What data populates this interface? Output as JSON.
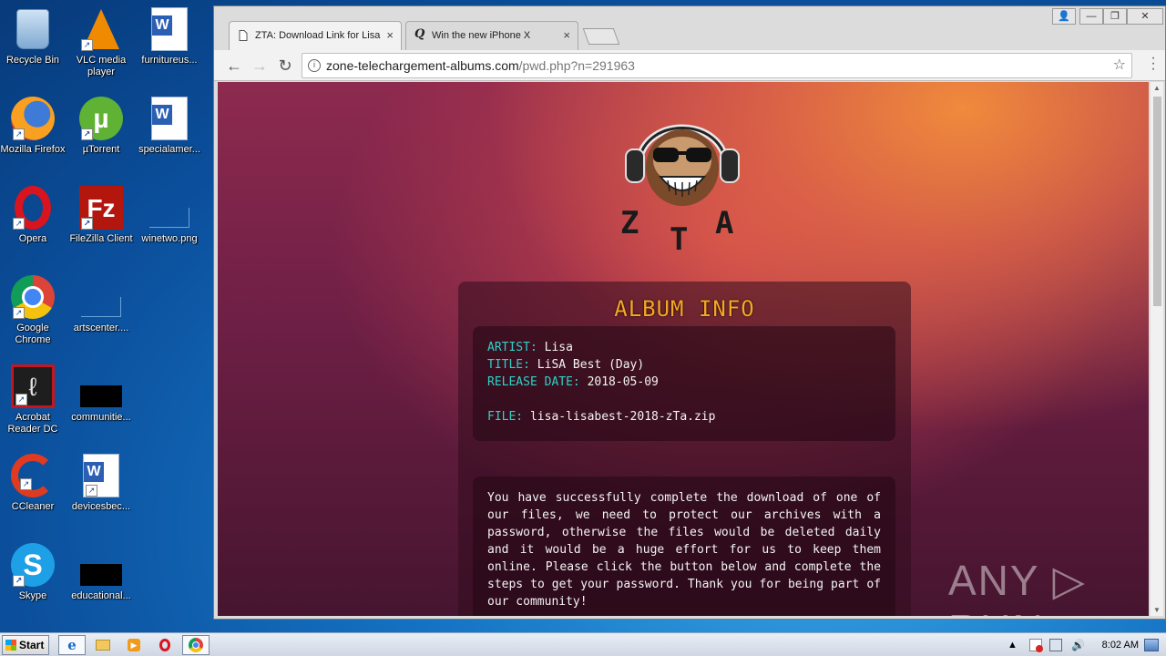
{
  "desktop": {
    "icons": [
      {
        "label": "Recycle Bin",
        "icon": "recycle-bin-icon"
      },
      {
        "label": "VLC media player",
        "icon": "vlc-icon"
      },
      {
        "label": "furnitureus...",
        "icon": "word-document-icon"
      },
      {
        "label": "Mozilla Firefox",
        "icon": "firefox-icon"
      },
      {
        "label": "µTorrent",
        "icon": "utorrent-icon"
      },
      {
        "label": "specialamer...",
        "icon": "word-document-icon"
      },
      {
        "label": "Opera",
        "icon": "opera-icon"
      },
      {
        "label": "FileZilla Client",
        "icon": "filezilla-icon"
      },
      {
        "label": "winetwo.png",
        "icon": "image-file-icon"
      },
      {
        "label": "Google Chrome",
        "icon": "chrome-icon"
      },
      {
        "label": "artscenter....",
        "icon": "file-icon"
      },
      {
        "label": "Acrobat Reader DC",
        "icon": "acrobat-icon"
      },
      {
        "label": "communitie...",
        "icon": "file-icon"
      },
      {
        "label": "CCleaner",
        "icon": "ccleaner-icon"
      },
      {
        "label": "devicesbec...",
        "icon": "word-document-icon"
      },
      {
        "label": "Skype",
        "icon": "skype-icon"
      },
      {
        "label": "educational...",
        "icon": "file-icon"
      }
    ]
  },
  "browser": {
    "tabs": [
      {
        "title": "ZTA: Download Link for Lisa",
        "close": "×",
        "active": true
      },
      {
        "title": "Win the new iPhone X",
        "close": "×",
        "active": false
      }
    ],
    "address": {
      "host": "zone-telechargement-albums.com",
      "path": "/pwd.php?n=291963"
    }
  },
  "page": {
    "logo_text": "ZTA",
    "album_title": "ALBUM INFO",
    "info": {
      "artist_label": "ARTIST:",
      "artist": "Lisa",
      "title_label": "TITLE:",
      "title": "LiSA Best (Day)",
      "release_label": "RELEASE DATE:",
      "release": "2018-05-09",
      "file_label": "FILE:",
      "file": "lisa-lisabest-2018-zTa.zip"
    },
    "description": "You have successfully complete the download of one of our files, we need to protect our archives with a password, otherwise the files would be deleted daily and it would be a huge effort for us to keep them online. Please click the button below and complete the steps to get your password. Thank you for being part of our community!",
    "watermark": "ANY ▷ RUN"
  },
  "taskbar": {
    "start_label": "Start",
    "clock": "8:02 AM"
  }
}
